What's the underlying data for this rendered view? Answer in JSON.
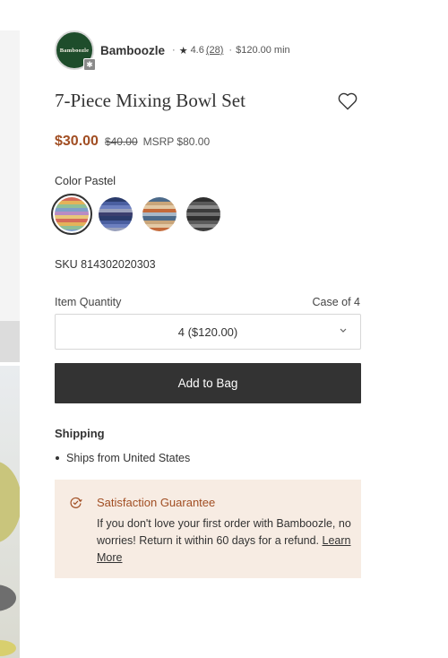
{
  "brand": {
    "logo_text": "Bamboozle",
    "name": "Bamboozle",
    "separator": "·",
    "rating": "4.6",
    "review_count": "(28)",
    "minimum": "$120.00 min"
  },
  "product": {
    "title": "7-Piece Mixing Bowl Set",
    "price": "$30.00",
    "original_price": "$40.00",
    "msrp": "MSRP $80.00",
    "color_label": "Color Pastel",
    "colors": [
      "Pastel",
      "Navy",
      "Earth",
      "Charcoal"
    ],
    "selected_color": "Pastel",
    "sku": "SKU 814302020303"
  },
  "quantity": {
    "label": "Item Quantity",
    "case": "Case of 4",
    "selected": "4 ($120.00)"
  },
  "actions": {
    "add_to_bag": "Add to Bag"
  },
  "shipping": {
    "title": "Shipping",
    "items": [
      "Ships from United States"
    ]
  },
  "guarantee": {
    "title": "Satisfaction Guarantee",
    "text": "If you don't love your first order with Bamboozle, no worries! Return it within 60 days for a refund.",
    "link": "Learn More"
  },
  "colors": {
    "accent": "#a14e23",
    "button": "#333333",
    "guarantee_bg": "#f7ece3"
  },
  "icons": [
    "star-icon",
    "heart-icon",
    "chevron-down-icon",
    "guarantee-icon"
  ]
}
